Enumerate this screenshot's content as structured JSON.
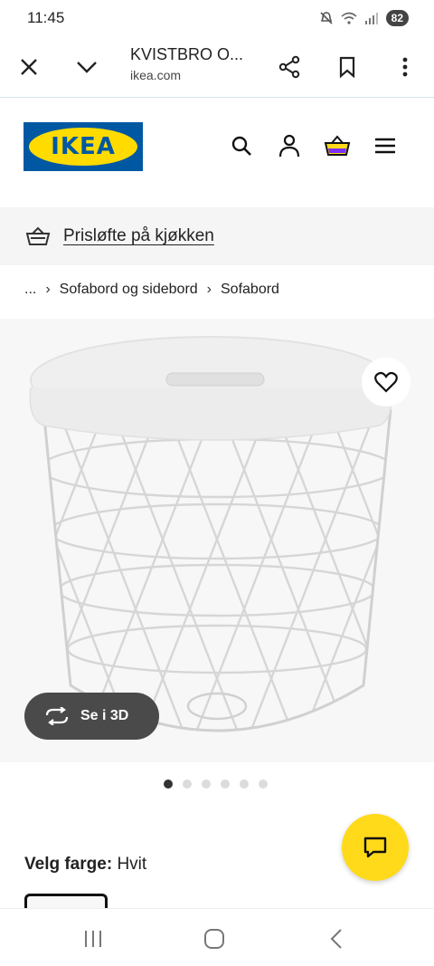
{
  "status_bar": {
    "time": "11:45",
    "battery": "82"
  },
  "browser": {
    "title": "KVISTBRO O...",
    "host": "ikea.com"
  },
  "logo": {
    "text": "IKEA"
  },
  "promo": {
    "label": "Prisløfte på kjøkken"
  },
  "breadcrumb": {
    "items": [
      "...",
      "Sofabord og sidebord",
      "Sofabord"
    ]
  },
  "product": {
    "view_3d_label": "Se i 3D",
    "image_count": 6,
    "active_image": 1
  },
  "color": {
    "label": "Velg farge:",
    "value": "Hvit"
  },
  "colors": {
    "ikea_blue": "#0058a3",
    "ikea_yellow": "#ffdb00",
    "chat_yellow": "#ffda1a"
  }
}
